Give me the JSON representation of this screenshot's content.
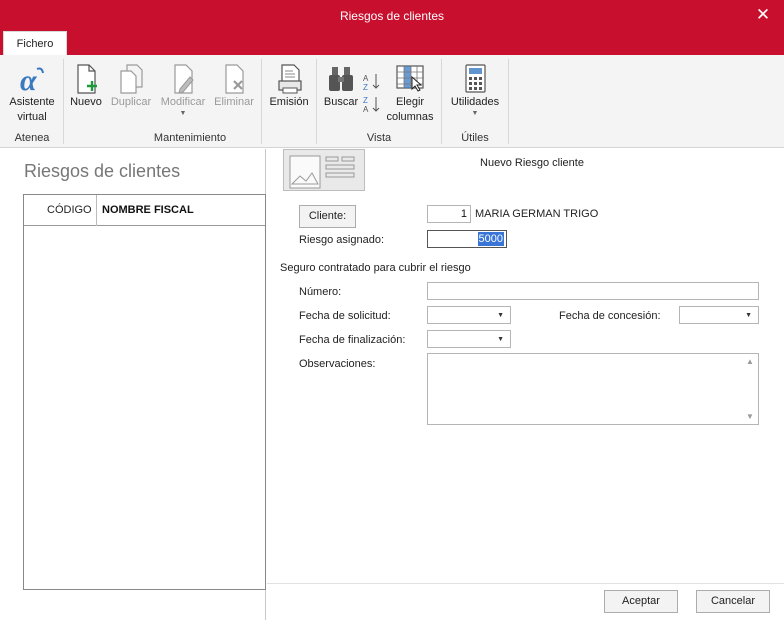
{
  "window": {
    "title": "Riesgos de clientes",
    "close_glyph": "✕"
  },
  "ribbon": {
    "tab": "Fichero",
    "buttons": {
      "asistente": [
        "Asistente",
        "virtual"
      ],
      "nuevo": "Nuevo",
      "duplicar": "Duplicar",
      "modificar": "Modificar",
      "eliminar": "Eliminar",
      "emision": "Emisión",
      "buscar": "Buscar",
      "elegir": [
        "Elegir",
        "columnas"
      ],
      "utilidades": "Utilidades"
    },
    "groups": {
      "atenea": "Atenea",
      "mantenimiento": "Mantenimiento",
      "vista": "Vista",
      "utiles": "Útiles"
    },
    "dropdown_glyph": "▼"
  },
  "left": {
    "title": "Riesgos de clientes",
    "columns": [
      "CÓDIGO",
      "NOMBRE FISCAL"
    ],
    "expander_glyph": "›"
  },
  "form": {
    "title": "Nuevo Riesgo cliente",
    "cliente_button": "Cliente:",
    "cliente_code": "1",
    "cliente_name": "MARIA GERMAN  TRIGO",
    "riesgo_label": "Riesgo asignado:",
    "riesgo_value": "5000",
    "seguro_section": "Seguro contratado para cubrir el riesgo",
    "numero_label": "Número:",
    "fecha_solicitud_label": "Fecha de solicitud:",
    "fecha_concesion_label": "Fecha de concesión:",
    "fecha_finalizacion_label": "Fecha de finalización:",
    "observaciones_label": "Observaciones:",
    "aceptar": "Aceptar",
    "cancelar": "Cancelar",
    "select_arrow": "▼",
    "scroll_up": "▲",
    "scroll_down": "▼"
  },
  "colors": {
    "accent": "#c8102e",
    "selection": "#3875d7",
    "ribbon_bg": "#f4f4f4"
  }
}
